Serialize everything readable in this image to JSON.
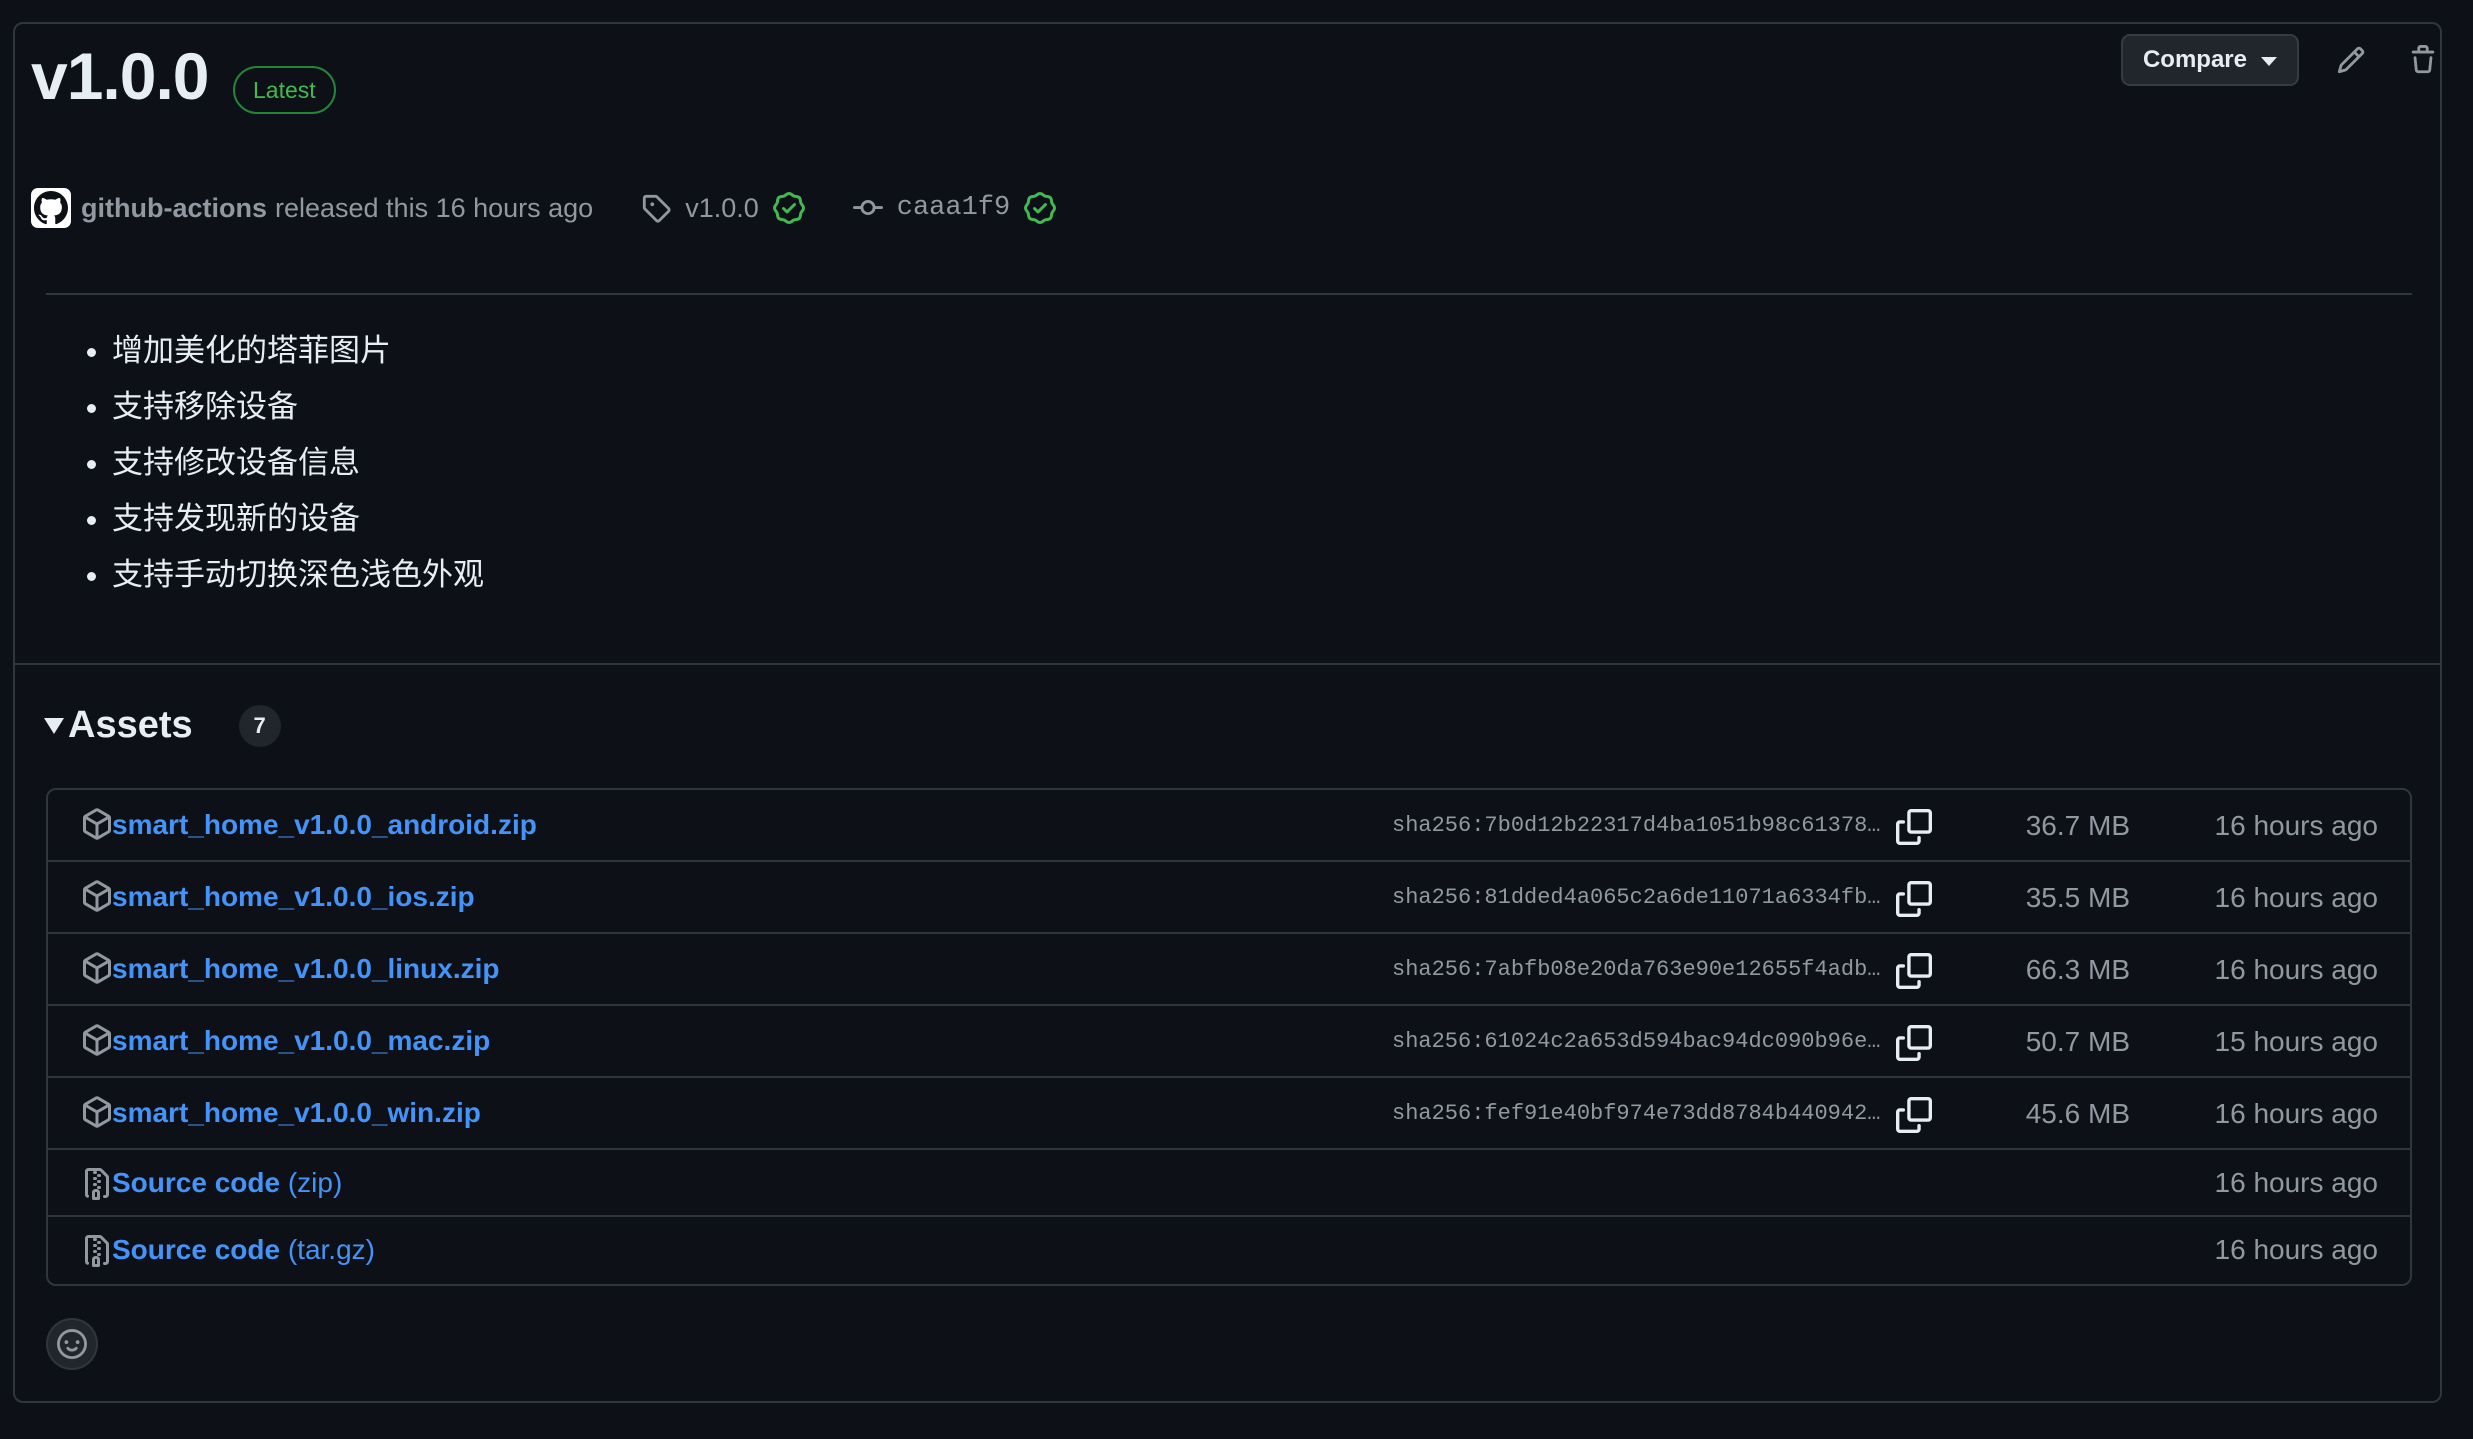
{
  "release": {
    "title": "v1.0.0",
    "badge": "Latest",
    "author": "github-actions",
    "released_text": "released this 16 hours ago",
    "tag": "v1.0.0",
    "commit": "caaa1f9"
  },
  "actions": {
    "compare_label": "Compare"
  },
  "notes": [
    "增加美化的塔菲图片",
    "支持移除设备",
    "支持修改设备信息",
    "支持发现新的设备",
    "支持手动切换深色浅色外观"
  ],
  "assets": {
    "title": "Assets",
    "count": "7",
    "files": [
      {
        "name": "smart_home_v1.0.0_android.zip",
        "sha": "sha256:7b0d12b22317d4ba1051b98c61378…",
        "size": "36.7 MB",
        "time": "16 hours ago"
      },
      {
        "name": "smart_home_v1.0.0_ios.zip",
        "sha": "sha256:81dded4a065c2a6de11071a6334fb…",
        "size": "35.5 MB",
        "time": "16 hours ago"
      },
      {
        "name": "smart_home_v1.0.0_linux.zip",
        "sha": "sha256:7abfb08e20da763e90e12655f4adb…",
        "size": "66.3 MB",
        "time": "16 hours ago"
      },
      {
        "name": "smart_home_v1.0.0_mac.zip",
        "sha": "sha256:61024c2a653d594bac94dc090b96e…",
        "size": "50.7 MB",
        "time": "15 hours ago"
      },
      {
        "name": "smart_home_v1.0.0_win.zip",
        "sha": "sha256:fef91e40bf974e73dd8784b440942…",
        "size": "45.6 MB",
        "time": "16 hours ago"
      }
    ],
    "source": [
      {
        "name": "Source code",
        "format": "(zip)",
        "time": "16 hours ago"
      },
      {
        "name": "Source code",
        "format": "(tar.gz)",
        "time": "16 hours ago"
      }
    ]
  },
  "icons": {
    "avatar": "github-mark-icon",
    "tag": "tag-icon",
    "commit": "git-commit-icon",
    "verified": "verified-check-icon",
    "edit": "pencil-icon",
    "delete": "trash-icon",
    "package": "package-icon",
    "file_zip": "file-zip-icon",
    "copy": "copy-icon",
    "reaction": "smiley-icon"
  },
  "colors": {
    "background": "#0d1117",
    "border": "#30363d",
    "link": "#4493f8",
    "success": "#3fb950",
    "muted": "#9198a1"
  }
}
